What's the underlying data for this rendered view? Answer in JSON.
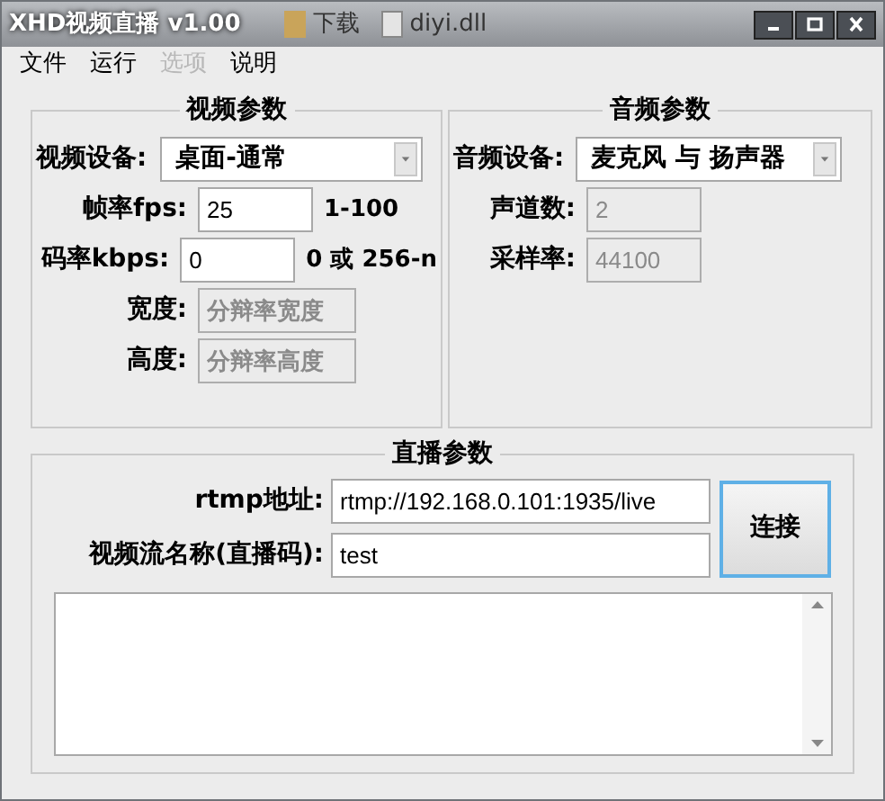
{
  "window": {
    "title": "XHD视频直播 v1.00",
    "desktop_items": [
      {
        "label": "下载"
      },
      {
        "label": "diyi.dll"
      }
    ]
  },
  "menu": [
    {
      "label": "文件",
      "disabled": false
    },
    {
      "label": "运行",
      "disabled": false
    },
    {
      "label": "选项",
      "disabled": true
    },
    {
      "label": "说明",
      "disabled": false
    }
  ],
  "video": {
    "title": "视频参数",
    "device": {
      "label": "视频设备:",
      "value": "桌面-通常"
    },
    "fields": [
      {
        "label": "帧率fps:",
        "value": "25",
        "hint": "1-100",
        "disabled": false
      },
      {
        "label": "码率kbps:",
        "value": "0",
        "hint": "0 或 256-n",
        "disabled": false
      },
      {
        "label": "宽度:",
        "value": "分辩率宽度",
        "disabled": true
      },
      {
        "label": "高度:",
        "value": "分辩率高度",
        "disabled": true
      }
    ]
  },
  "audio": {
    "title": "音频参数",
    "device": {
      "label": "音频设备:",
      "value": "麦克风 与 扬声器"
    },
    "fields": [
      {
        "label": "声道数:",
        "value": "2",
        "disabled": true
      },
      {
        "label": "采样率:",
        "value": "44100",
        "disabled": true
      }
    ]
  },
  "live": {
    "title": "直播参数",
    "fields": [
      {
        "label": "rtmp地址:",
        "value": "rtmp://192.168.0.101:1935/live"
      },
      {
        "label": "视频流名称(直播码):",
        "value": "test"
      }
    ],
    "connect_button": "连接"
  }
}
